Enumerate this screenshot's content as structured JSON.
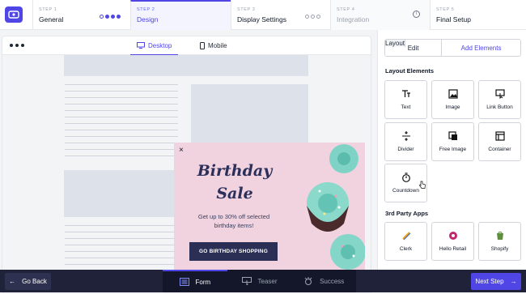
{
  "steps": [
    {
      "num": "STEP 1",
      "title": "General"
    },
    {
      "num": "STEP 2",
      "title": "Design"
    },
    {
      "num": "STEP 3",
      "title": "Display Settings"
    },
    {
      "num": "STEP 4",
      "title": "Integration"
    },
    {
      "num": "STEP 5",
      "title": "Final Setup"
    }
  ],
  "devices": {
    "desktop": "Desktop",
    "mobile": "Mobile"
  },
  "popup": {
    "close": "×",
    "title1": "Birthday",
    "title2": "Sale",
    "text": "Get up to 30% off selected birthday items!",
    "button": "GO BIRTHDAY SHOPPING"
  },
  "panel": {
    "tabs": [
      "Edit",
      "Layout",
      "Add Elements"
    ],
    "layout_title": "Layout Elements",
    "layout_items": [
      "Text",
      "Image",
      "Link Button",
      "Divider",
      "Free Image",
      "Container",
      "Countdown"
    ],
    "apps_title": "3rd Party Apps",
    "apps": [
      "Clerk",
      "Hello Retail",
      "Shopify"
    ]
  },
  "bottom": {
    "back": "Go Back",
    "tabs": [
      "Form",
      "Teaser",
      "Success"
    ],
    "next": "Next Step"
  },
  "colors": {
    "accent": "#4f46e5",
    "popup_bg": "#f1d3e0",
    "popup_button": "#2b2f55",
    "bottom_bar": "#1f2238"
  }
}
